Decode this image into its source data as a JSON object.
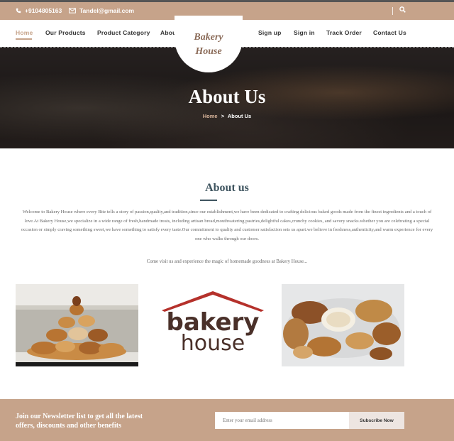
{
  "topbar": {
    "phone": "+9104805163",
    "email": "Tandel@gmail.com",
    "icons": {
      "phone": "phone-icon",
      "email": "envelope-icon",
      "search": "search-icon"
    }
  },
  "nav": {
    "left": [
      "Home",
      "Our Products",
      "Product Category",
      "About Us"
    ],
    "right": [
      "Sign up",
      "Sign in",
      "Track Order",
      "Contact Us"
    ],
    "active": "Home"
  },
  "logo": {
    "line1": "Bakery",
    "line2": "House"
  },
  "hero": {
    "title": "About Us",
    "breadcrumb": {
      "home": "Home",
      "separator": ">",
      "current": "About Us"
    }
  },
  "about": {
    "heading": "About us",
    "paragraph": "Welcome to Bakery House where every Bite tells a story of passion,quality,and tradition,since our establishment,we have been dedicated to crafting delicious baked goods made from the finest ingredients and a touch of love.At Bakery House,we specialize in a wide range of fresh,handmade treats, including artisan bread,mouthwatering pastries,delightful cakes,crunchy cookies, and savory snacks.whether you are celebrating a special occasion or simply craving something sweet,we have something to satisfy every taste.Our commitment to quality and customer satisfaction sets us apart.we believe in freshness,authenticity,and warm experience for every one who walks through our doors.",
    "invite": "Come visit us and experience the magic of homemade goodness at Bakery House..."
  },
  "gallery": {
    "brand_top": "bakery",
    "brand_bottom": "house"
  },
  "newsletter": {
    "line1": "Join our Newsletter list to get all the latest",
    "line2": "offers, discounts and other benefits",
    "placeholder": "Enter your email address",
    "button": "Subscribe Now"
  },
  "colors": {
    "accent": "#c6a38a",
    "heading": "#3f5560",
    "brand_red": "#b5312b",
    "brand_dark": "#4a3029"
  }
}
